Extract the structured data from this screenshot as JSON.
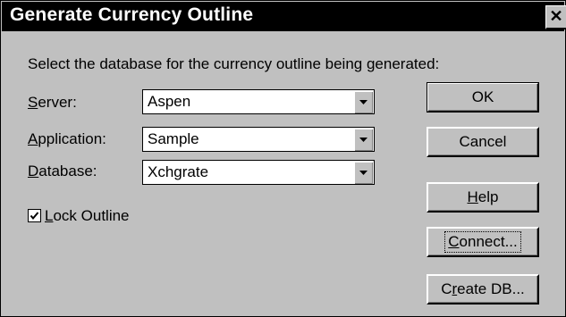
{
  "dialog": {
    "title": "Generate Currency Outline",
    "close_glyph": "✕",
    "prompt": "Select the database for the currency outline being generated:"
  },
  "fields": [
    {
      "label_accel": "S",
      "label_rest": "erver:",
      "value": "Aspen"
    },
    {
      "label_accel": "A",
      "label_rest": "pplication:",
      "value": "Sample"
    },
    {
      "label_accel": "D",
      "label_rest": "atabase:",
      "value": "Xchgrate"
    }
  ],
  "lock_outline": {
    "accel": "L",
    "rest": "ock Outline",
    "checked": true
  },
  "buttons": {
    "ok": "OK",
    "cancel": "Cancel",
    "help_accel": "H",
    "help_rest": "elp",
    "connect_accel": "C",
    "connect_rest": "onnect...",
    "createdb_pre": "C",
    "createdb_accel": "r",
    "createdb_rest": "eate DB..."
  },
  "icons": {
    "dropdown": "chevron-down-icon",
    "check": "check-icon",
    "close": "close-icon"
  }
}
